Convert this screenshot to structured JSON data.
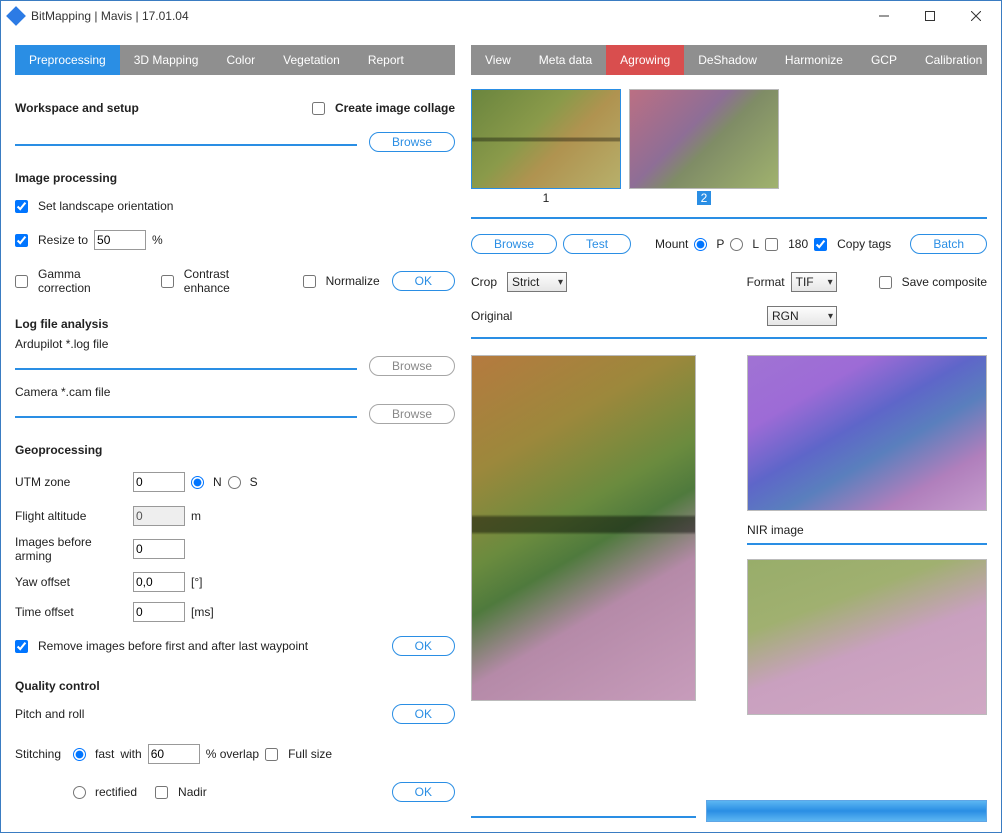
{
  "window": {
    "title": "BitMapping | Mavis | 17.01.04"
  },
  "left_tabs": [
    "Preprocessing",
    "3D Mapping",
    "Color",
    "Vegetation",
    "Report"
  ],
  "right_tabs": [
    "View",
    "Meta data",
    "Agrowing",
    "DeShadow",
    "Harmonize",
    "GCP",
    "Calibration"
  ],
  "left_tab_active": 0,
  "right_tab_active": 2,
  "workspace": {
    "heading": "Workspace and setup",
    "create_collage": "Create image collage",
    "browse": "Browse"
  },
  "imgproc": {
    "heading": "Image processing",
    "landscape": "Set landscape orientation",
    "resize_label": "Resize to",
    "resize_val": "50",
    "resize_pct": "%",
    "gamma": "Gamma correction",
    "contrast": "Contrast enhance",
    "normalize": "Normalize",
    "ok": "OK"
  },
  "logs": {
    "heading": "Log file analysis",
    "ardu": "Ardupilot *.log file",
    "cam": "Camera *.cam file",
    "browse": "Browse"
  },
  "geo": {
    "heading": "Geoprocessing",
    "utm": "UTM zone",
    "utm_val": "0",
    "n": "N",
    "s": "S",
    "alt": "Flight altitude",
    "alt_val": "0",
    "m": "m",
    "before": "Images before arming",
    "before_val": "0",
    "yaw": "Yaw offset",
    "yaw_val": "0,0",
    "deg": "[°]",
    "time": "Time offset",
    "time_val": "0",
    "ms": "[ms]",
    "remove": "Remove images before first and after last waypoint",
    "ok": "OK"
  },
  "qc": {
    "heading": "Quality control",
    "pitch": "Pitch and roll",
    "stitch": "Stitching",
    "fast": "fast",
    "with": "with",
    "overlap_val": "60",
    "overlap_txt": "% overlap",
    "fullsize": "Full size",
    "rectified": "rectified",
    "nadir": "Nadir",
    "ok": "OK"
  },
  "right": {
    "thumb1": "1",
    "thumb2": "2",
    "browse": "Browse",
    "test": "Test",
    "mount": "Mount",
    "p": "P",
    "l": "L",
    "r180": "180",
    "copytags": "Copy tags",
    "batch": "Batch",
    "crop": "Crop",
    "crop_val": "Strict",
    "format": "Format",
    "format_val": "TIF",
    "savecomp": "Save composite",
    "original": "Original",
    "orig_val": "RGN",
    "nir": "NIR image"
  }
}
